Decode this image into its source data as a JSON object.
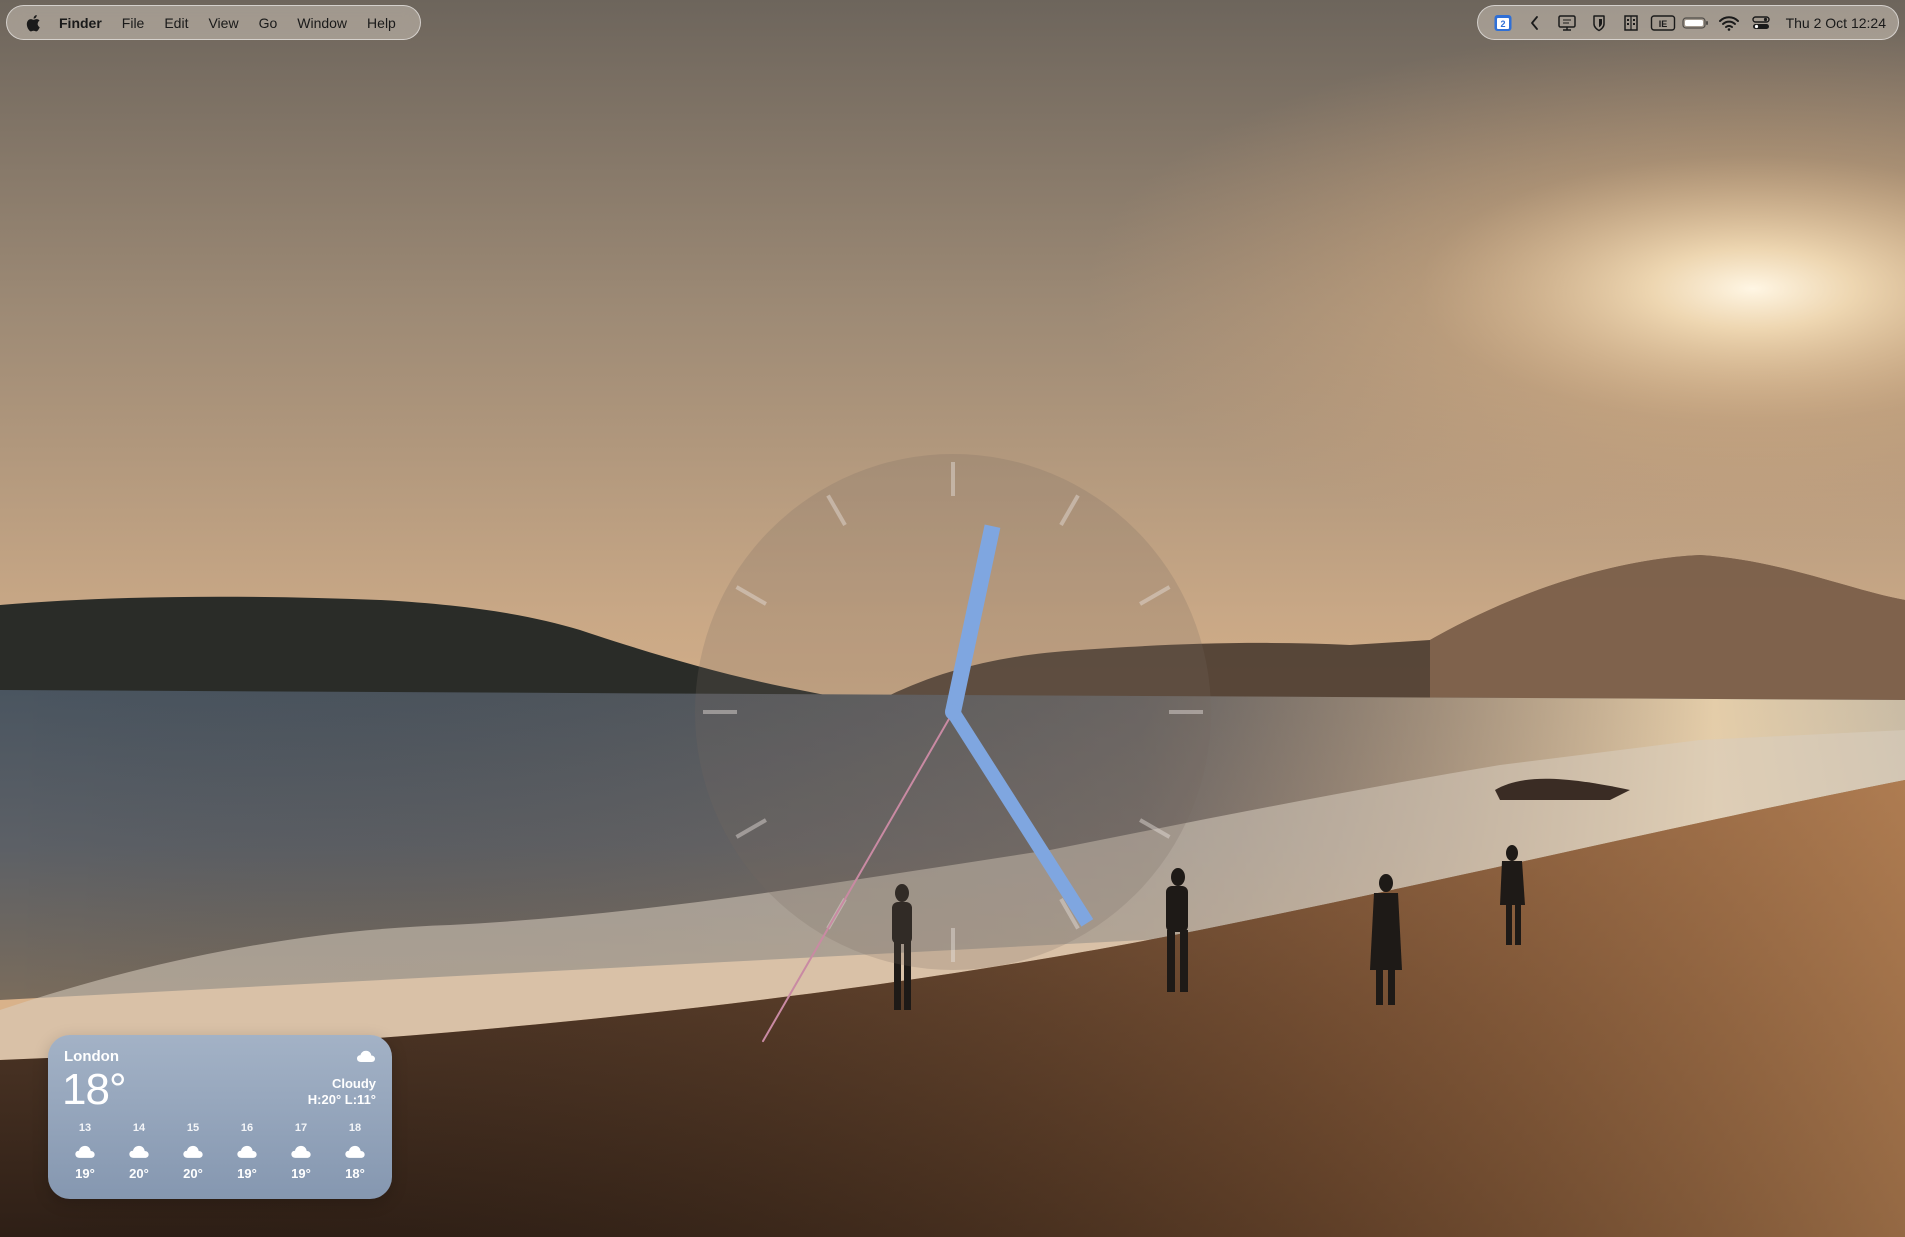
{
  "menubar": {
    "apple_icon": "apple-logo-icon",
    "items": [
      {
        "label": "Finder"
      },
      {
        "label": "File"
      },
      {
        "label": "Edit"
      },
      {
        "label": "View"
      },
      {
        "label": "Go"
      },
      {
        "label": "Window"
      },
      {
        "label": "Help"
      }
    ]
  },
  "status_bar": {
    "calendar_badge": "2",
    "icons": [
      "calendar-badge-icon",
      "chevron-left-icon",
      "display-icon",
      "shield-icon",
      "building-icon",
      "keyboard-input-icon",
      "battery-icon",
      "wifi-icon",
      "control-center-icon"
    ],
    "input_source_label": "IE",
    "date_time": "Thu 2 Oct  12:24"
  },
  "clock_widget": {
    "hour": 12,
    "minute": 24,
    "second": 35,
    "hand_color": "#7fa6e0",
    "second_hand_color": "#c98aa3"
  },
  "weather": {
    "city": "London",
    "temperature": "18°",
    "condition": "Cloudy",
    "high_low": "H:20° L:11°",
    "condition_icon": "cloud-icon",
    "forecast": [
      {
        "hour": "13",
        "temp": "19°",
        "icon": "cloud-icon"
      },
      {
        "hour": "14",
        "temp": "20°",
        "icon": "cloud-icon"
      },
      {
        "hour": "15",
        "temp": "20°",
        "icon": "cloud-icon"
      },
      {
        "hour": "16",
        "temp": "19°",
        "icon": "cloud-icon"
      },
      {
        "hour": "17",
        "temp": "19°",
        "icon": "cloud-icon"
      },
      {
        "hour": "18",
        "temp": "18°",
        "icon": "cloud-icon"
      }
    ]
  }
}
